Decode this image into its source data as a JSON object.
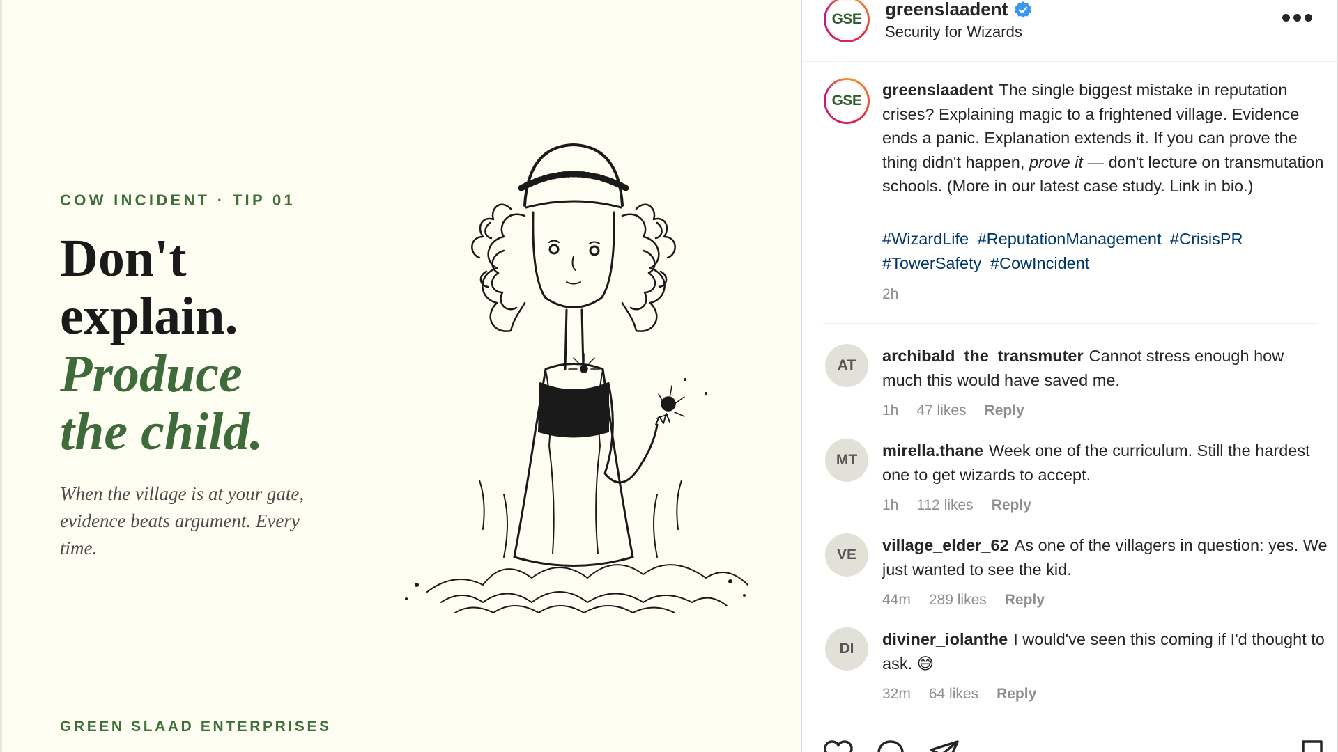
{
  "post_image": {
    "eyebrow": "COW INCIDENT · TIP 01",
    "headline_line1": "Don't",
    "headline_line2": "explain.",
    "headline_line3": "Produce",
    "headline_line4": "the child.",
    "tagline": "When the village is at your gate, evidence beats argument. Every time.",
    "brand": "GREEN SLAAD ENTERPRISES",
    "illustration_icon": "pen-and-ink-girl-illustration"
  },
  "header": {
    "avatar_initials": "GSE",
    "username": "greenslaadent",
    "verified_icon": "verified-badge-icon",
    "subtitle": "Security for Wizards",
    "more_icon": "more-options-icon"
  },
  "caption": {
    "avatar_initials": "GSE",
    "username": "greenslaadent",
    "text_before": "The single biggest mistake in reputation crises? Explaining magic to a frightened village. Evidence ends a panic. Explanation extends it. If you can prove the thing didn't happen, ",
    "text_italic": "prove it",
    "text_after": " — don't lecture on transmutation schools. (More in our latest case study. Link in bio.)",
    "hashtags": [
      "#WizardLife",
      "#ReputationManagement",
      "#CrisisPR",
      "#TowerSafety",
      "#CowIncident"
    ],
    "time": "2h"
  },
  "comments": [
    {
      "initials": "AT",
      "username": "archibald_the_transmuter",
      "text": "Cannot stress enough how much this would have saved me.",
      "time": "1h",
      "likes": "47 likes",
      "reply": "Reply"
    },
    {
      "initials": "MT",
      "username": "mirella.thane",
      "text": "Week one of the curriculum. Still the hardest one to get wizards to accept.",
      "time": "1h",
      "likes": "112 likes",
      "reply": "Reply"
    },
    {
      "initials": "VE",
      "username": "village_elder_62",
      "text": "As one of the villagers in question: yes. We just wanted to see the kid.",
      "time": "44m",
      "likes": "289 likes",
      "reply": "Reply"
    },
    {
      "initials": "DI",
      "username": "diviner_iolanthe",
      "text": "I would've seen this coming if I'd thought to ask. 😅",
      "time": "32m",
      "likes": "64 likes",
      "reply": "Reply"
    }
  ],
  "actions": {
    "like_icon": "heart-icon",
    "comment_icon": "comment-bubble-icon",
    "share_icon": "paper-plane-icon",
    "save_icon": "bookmark-icon"
  },
  "colors": {
    "brand_green": "#3e6e3a",
    "hashtag_blue": "#00376b",
    "verified_blue": "#3897f0",
    "muted_gray": "#8e8e8e"
  }
}
